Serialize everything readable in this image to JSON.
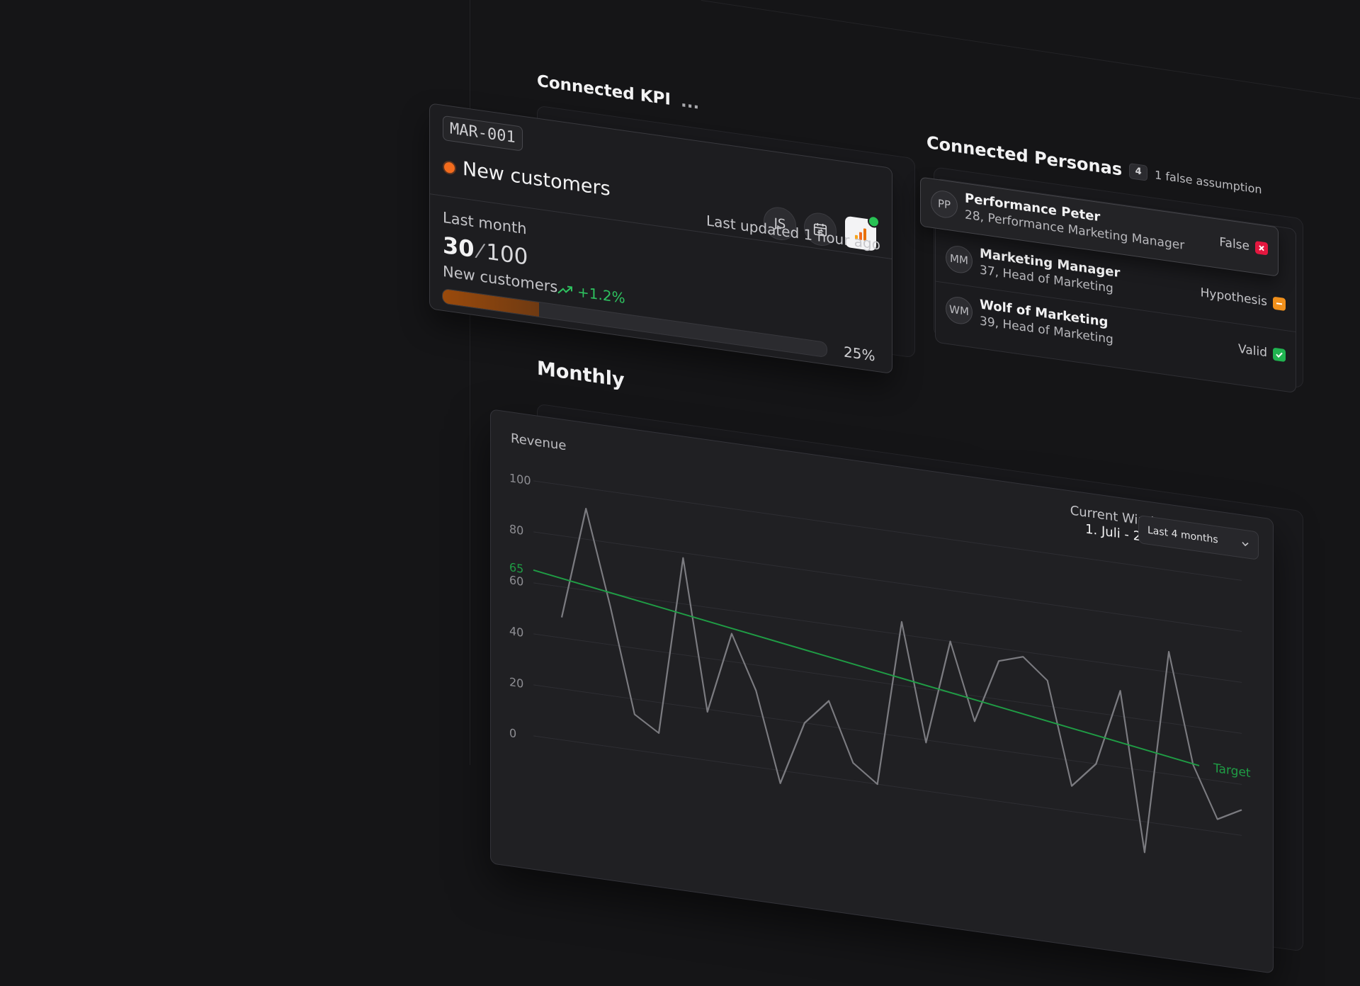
{
  "kpi_section": {
    "title": "Connected KPI",
    "menu": "..."
  },
  "kpi": {
    "code": "MAR-001",
    "name": "New customers",
    "status_color": "#f26b1d",
    "owner_initials": "JS",
    "calendar_icon": "calendar-sync-icon",
    "analytics_icon": "analytics-bars-icon",
    "last_updated": "Last updated 1 hour ago",
    "period_label": "Last month",
    "current": "30",
    "target": "100",
    "metric_label": "New customers",
    "trend": "+1.2%",
    "progress": 0.25,
    "progress_label": "25%",
    "accent": "#f26b1d",
    "trend_color": "#2ec15f"
  },
  "personas_section": {
    "title": "Connected Personas",
    "count": "4",
    "note": "1 false assumption",
    "items": [
      {
        "initials": "PP",
        "name": "Performance Peter",
        "desc": "28, Performance Marketing Manager",
        "status": "False",
        "status_icon": "x-icon",
        "status_color": "#e4173f"
      },
      {
        "initials": "MM",
        "name": "Marketing Manager",
        "desc": "37, Head of Marketing",
        "status": "Hypothesis",
        "status_icon": "minus-icon",
        "status_color": "#f0901c"
      },
      {
        "initials": "WM",
        "name": "Wolf of Marketing",
        "desc": "39, Head of Marketing",
        "status": "Valid",
        "status_icon": "check-icon",
        "status_color": "#20b350"
      }
    ]
  },
  "monthly_section": {
    "title": "Monthly"
  },
  "chart": {
    "metric_label": "Revenue",
    "window_label": "Current Window",
    "window_range": "1. Juli - 22 Juli",
    "range_select": "Last 4 months",
    "line_color": "#7b7b80",
    "target_color": "#1f9d45"
  },
  "chart_data": {
    "type": "line",
    "ylim": [
      0,
      100
    ],
    "yticks": [
      0,
      20,
      40,
      60,
      80,
      100
    ],
    "target_tick": 65,
    "series": [
      {
        "values": [
          48,
          92,
          55,
          14,
          8,
          78,
          19,
          51,
          30,
          -5,
          20,
          30,
          7,
          0,
          65,
          19,
          60,
          30,
          55,
          58,
          50,
          10,
          20,
          50,
          -12,
          68,
          25,
          5,
          10
        ]
      }
    ],
    "target": {
      "name": "Target",
      "start": 65,
      "end": 25
    }
  }
}
